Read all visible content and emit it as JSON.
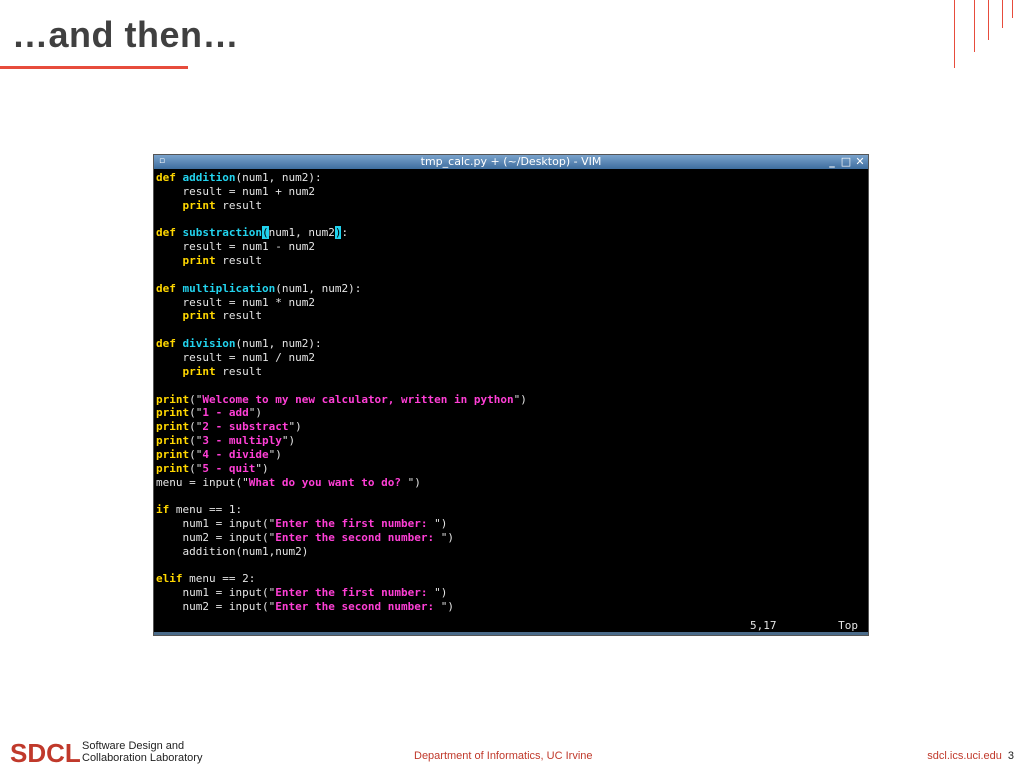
{
  "slide": {
    "title": "…and then…",
    "accent_color": "#e74c3c"
  },
  "vim": {
    "window_title": "tmp_calc.py + (~/Desktop) - VIM",
    "menu_icon": "window-menu-icon",
    "controls": [
      {
        "icon": "minimize-icon",
        "glyph": "_"
      },
      {
        "icon": "maximize-icon",
        "glyph": "□"
      },
      {
        "icon": "close-icon",
        "glyph": "✕"
      }
    ],
    "lines": [
      [
        {
          "t": "def",
          "c": "kw-def"
        },
        {
          "t": " "
        },
        {
          "t": "addition",
          "c": "fn"
        },
        {
          "t": "(num1, num2):"
        }
      ],
      [
        {
          "t": "    result = num1 + num2"
        }
      ],
      [
        {
          "t": "    "
        },
        {
          "t": "print",
          "c": "kw-def"
        },
        {
          "t": " result"
        }
      ],
      [],
      [
        {
          "t": "def",
          "c": "kw-def"
        },
        {
          "t": " "
        },
        {
          "t": "substraction",
          "c": "fn"
        },
        {
          "t": "(",
          "c": "cur"
        },
        {
          "t": "num1, num2"
        },
        {
          "t": ")",
          "c": "cur"
        },
        {
          "t": ":"
        }
      ],
      [
        {
          "t": "    result = num1 - num2"
        }
      ],
      [
        {
          "t": "    "
        },
        {
          "t": "print",
          "c": "kw-def"
        },
        {
          "t": " result"
        }
      ],
      [],
      [
        {
          "t": "def",
          "c": "kw-def"
        },
        {
          "t": " "
        },
        {
          "t": "multiplication",
          "c": "fn"
        },
        {
          "t": "(num1, num2):"
        }
      ],
      [
        {
          "t": "    result = num1 * num2"
        }
      ],
      [
        {
          "t": "    "
        },
        {
          "t": "print",
          "c": "kw-def"
        },
        {
          "t": " result"
        }
      ],
      [],
      [
        {
          "t": "def",
          "c": "kw-def"
        },
        {
          "t": " "
        },
        {
          "t": "division",
          "c": "fn"
        },
        {
          "t": "(num1, num2):"
        }
      ],
      [
        {
          "t": "    result = num1 / num2"
        }
      ],
      [
        {
          "t": "    "
        },
        {
          "t": "print",
          "c": "kw-def"
        },
        {
          "t": " result"
        }
      ],
      [],
      [
        {
          "t": "print",
          "c": "kw-def"
        },
        {
          "t": "(\""
        },
        {
          "t": "Welcome to my new calculator, written in python",
          "c": "str"
        },
        {
          "t": "\")"
        }
      ],
      [
        {
          "t": "print",
          "c": "kw-def"
        },
        {
          "t": "(\""
        },
        {
          "t": "1 - add",
          "c": "str"
        },
        {
          "t": "\")"
        }
      ],
      [
        {
          "t": "print",
          "c": "kw-def"
        },
        {
          "t": "(\""
        },
        {
          "t": "2 - substract",
          "c": "str"
        },
        {
          "t": "\")"
        }
      ],
      [
        {
          "t": "print",
          "c": "kw-def"
        },
        {
          "t": "(\""
        },
        {
          "t": "3 - multiply",
          "c": "str"
        },
        {
          "t": "\")"
        }
      ],
      [
        {
          "t": "print",
          "c": "kw-def"
        },
        {
          "t": "(\""
        },
        {
          "t": "4 - divide",
          "c": "str"
        },
        {
          "t": "\")"
        }
      ],
      [
        {
          "t": "print",
          "c": "kw-def"
        },
        {
          "t": "(\""
        },
        {
          "t": "5 - quit",
          "c": "str"
        },
        {
          "t": "\")"
        }
      ],
      [
        {
          "t": "menu = input(\""
        },
        {
          "t": "What do you want to do?",
          "c": "str"
        },
        {
          "t": " \")"
        }
      ],
      [],
      [
        {
          "t": "if",
          "c": "kw-def"
        },
        {
          "t": " menu == 1:"
        }
      ],
      [
        {
          "t": "    num1 = input(\""
        },
        {
          "t": "Enter the first number:",
          "c": "str"
        },
        {
          "t": " \")"
        }
      ],
      [
        {
          "t": "    num2 = input(\""
        },
        {
          "t": "Enter the second number:",
          "c": "str"
        },
        {
          "t": " \")"
        }
      ],
      [
        {
          "t": "    addition(num1,num2)"
        }
      ],
      [],
      [
        {
          "t": "elif",
          "c": "kw-def"
        },
        {
          "t": " menu == 2:"
        }
      ],
      [
        {
          "t": "    num1 = input(\""
        },
        {
          "t": "Enter the first number:",
          "c": "str"
        },
        {
          "t": " \")"
        }
      ],
      [
        {
          "t": "    num2 = input(\""
        },
        {
          "t": "Enter the second number:",
          "c": "str"
        },
        {
          "t": " \")"
        }
      ]
    ],
    "status": {
      "position": "5,17",
      "scroll": "Top"
    },
    "colors": {
      "keyword": "#ffd700",
      "function": "#22d3ee",
      "string": "#ff3fd6",
      "background": "#000000"
    }
  },
  "footer": {
    "logo": "SDCL",
    "subtitle_line1": "Software Design and",
    "subtitle_line2": "Collaboration Laboratory",
    "department": "Department of Informatics, UC Irvine",
    "url": "sdcl.ics.uci.edu",
    "page_number": "3"
  }
}
